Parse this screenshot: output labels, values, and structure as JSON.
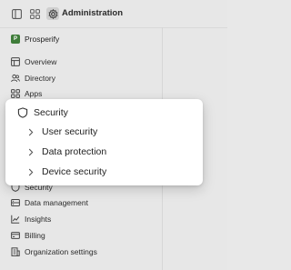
{
  "topbar": {
    "title": "Administration",
    "icons": [
      "sidebar-toggle-icon",
      "apps-grid-icon",
      "gear-icon"
    ]
  },
  "org": {
    "initial": "P",
    "name": "Prosperify",
    "logo_color": "#3f7d3a"
  },
  "nav": {
    "top_items": [
      {
        "label": "Overview",
        "icon": "overview-icon"
      },
      {
        "label": "Directory",
        "icon": "users-icon"
      },
      {
        "label": "Apps",
        "icon": "apps-icon"
      }
    ],
    "bottom_items": [
      {
        "label": "Security",
        "icon": "shield-icon"
      },
      {
        "label": "Data management",
        "icon": "database-icon"
      },
      {
        "label": "Insights",
        "icon": "chart-icon"
      },
      {
        "label": "Billing",
        "icon": "billing-icon"
      },
      {
        "label": "Organization settings",
        "icon": "building-icon"
      }
    ]
  },
  "popover": {
    "title": "Security",
    "icon": "shield-icon",
    "items": [
      {
        "label": "User security"
      },
      {
        "label": "Data protection"
      },
      {
        "label": "Device security"
      }
    ]
  }
}
